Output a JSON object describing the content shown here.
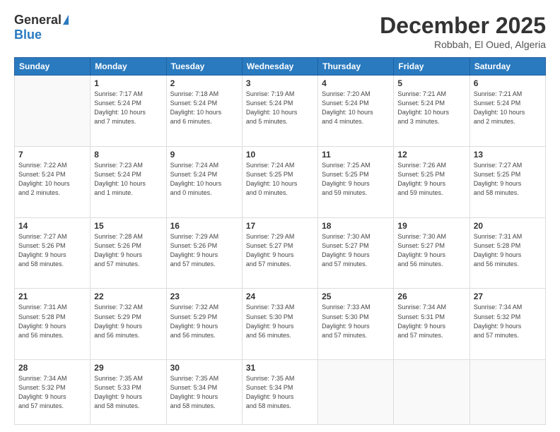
{
  "logo": {
    "general": "General",
    "blue": "Blue"
  },
  "title": "December 2025",
  "subtitle": "Robbah, El Oued, Algeria",
  "days_header": [
    "Sunday",
    "Monday",
    "Tuesday",
    "Wednesday",
    "Thursday",
    "Friday",
    "Saturday"
  ],
  "weeks": [
    [
      {
        "day": "",
        "info": ""
      },
      {
        "day": "1",
        "info": "Sunrise: 7:17 AM\nSunset: 5:24 PM\nDaylight: 10 hours\nand 7 minutes."
      },
      {
        "day": "2",
        "info": "Sunrise: 7:18 AM\nSunset: 5:24 PM\nDaylight: 10 hours\nand 6 minutes."
      },
      {
        "day": "3",
        "info": "Sunrise: 7:19 AM\nSunset: 5:24 PM\nDaylight: 10 hours\nand 5 minutes."
      },
      {
        "day": "4",
        "info": "Sunrise: 7:20 AM\nSunset: 5:24 PM\nDaylight: 10 hours\nand 4 minutes."
      },
      {
        "day": "5",
        "info": "Sunrise: 7:21 AM\nSunset: 5:24 PM\nDaylight: 10 hours\nand 3 minutes."
      },
      {
        "day": "6",
        "info": "Sunrise: 7:21 AM\nSunset: 5:24 PM\nDaylight: 10 hours\nand 2 minutes."
      }
    ],
    [
      {
        "day": "7",
        "info": "Sunrise: 7:22 AM\nSunset: 5:24 PM\nDaylight: 10 hours\nand 2 minutes."
      },
      {
        "day": "8",
        "info": "Sunrise: 7:23 AM\nSunset: 5:24 PM\nDaylight: 10 hours\nand 1 minute."
      },
      {
        "day": "9",
        "info": "Sunrise: 7:24 AM\nSunset: 5:24 PM\nDaylight: 10 hours\nand 0 minutes."
      },
      {
        "day": "10",
        "info": "Sunrise: 7:24 AM\nSunset: 5:25 PM\nDaylight: 10 hours\nand 0 minutes."
      },
      {
        "day": "11",
        "info": "Sunrise: 7:25 AM\nSunset: 5:25 PM\nDaylight: 9 hours\nand 59 minutes."
      },
      {
        "day": "12",
        "info": "Sunrise: 7:26 AM\nSunset: 5:25 PM\nDaylight: 9 hours\nand 59 minutes."
      },
      {
        "day": "13",
        "info": "Sunrise: 7:27 AM\nSunset: 5:25 PM\nDaylight: 9 hours\nand 58 minutes."
      }
    ],
    [
      {
        "day": "14",
        "info": "Sunrise: 7:27 AM\nSunset: 5:26 PM\nDaylight: 9 hours\nand 58 minutes."
      },
      {
        "day": "15",
        "info": "Sunrise: 7:28 AM\nSunset: 5:26 PM\nDaylight: 9 hours\nand 57 minutes."
      },
      {
        "day": "16",
        "info": "Sunrise: 7:29 AM\nSunset: 5:26 PM\nDaylight: 9 hours\nand 57 minutes."
      },
      {
        "day": "17",
        "info": "Sunrise: 7:29 AM\nSunset: 5:27 PM\nDaylight: 9 hours\nand 57 minutes."
      },
      {
        "day": "18",
        "info": "Sunrise: 7:30 AM\nSunset: 5:27 PM\nDaylight: 9 hours\nand 57 minutes."
      },
      {
        "day": "19",
        "info": "Sunrise: 7:30 AM\nSunset: 5:27 PM\nDaylight: 9 hours\nand 56 minutes."
      },
      {
        "day": "20",
        "info": "Sunrise: 7:31 AM\nSunset: 5:28 PM\nDaylight: 9 hours\nand 56 minutes."
      }
    ],
    [
      {
        "day": "21",
        "info": "Sunrise: 7:31 AM\nSunset: 5:28 PM\nDaylight: 9 hours\nand 56 minutes."
      },
      {
        "day": "22",
        "info": "Sunrise: 7:32 AM\nSunset: 5:29 PM\nDaylight: 9 hours\nand 56 minutes."
      },
      {
        "day": "23",
        "info": "Sunrise: 7:32 AM\nSunset: 5:29 PM\nDaylight: 9 hours\nand 56 minutes."
      },
      {
        "day": "24",
        "info": "Sunrise: 7:33 AM\nSunset: 5:30 PM\nDaylight: 9 hours\nand 56 minutes."
      },
      {
        "day": "25",
        "info": "Sunrise: 7:33 AM\nSunset: 5:30 PM\nDaylight: 9 hours\nand 57 minutes."
      },
      {
        "day": "26",
        "info": "Sunrise: 7:34 AM\nSunset: 5:31 PM\nDaylight: 9 hours\nand 57 minutes."
      },
      {
        "day": "27",
        "info": "Sunrise: 7:34 AM\nSunset: 5:32 PM\nDaylight: 9 hours\nand 57 minutes."
      }
    ],
    [
      {
        "day": "28",
        "info": "Sunrise: 7:34 AM\nSunset: 5:32 PM\nDaylight: 9 hours\nand 57 minutes."
      },
      {
        "day": "29",
        "info": "Sunrise: 7:35 AM\nSunset: 5:33 PM\nDaylight: 9 hours\nand 58 minutes."
      },
      {
        "day": "30",
        "info": "Sunrise: 7:35 AM\nSunset: 5:34 PM\nDaylight: 9 hours\nand 58 minutes."
      },
      {
        "day": "31",
        "info": "Sunrise: 7:35 AM\nSunset: 5:34 PM\nDaylight: 9 hours\nand 58 minutes."
      },
      {
        "day": "",
        "info": ""
      },
      {
        "day": "",
        "info": ""
      },
      {
        "day": "",
        "info": ""
      }
    ]
  ]
}
